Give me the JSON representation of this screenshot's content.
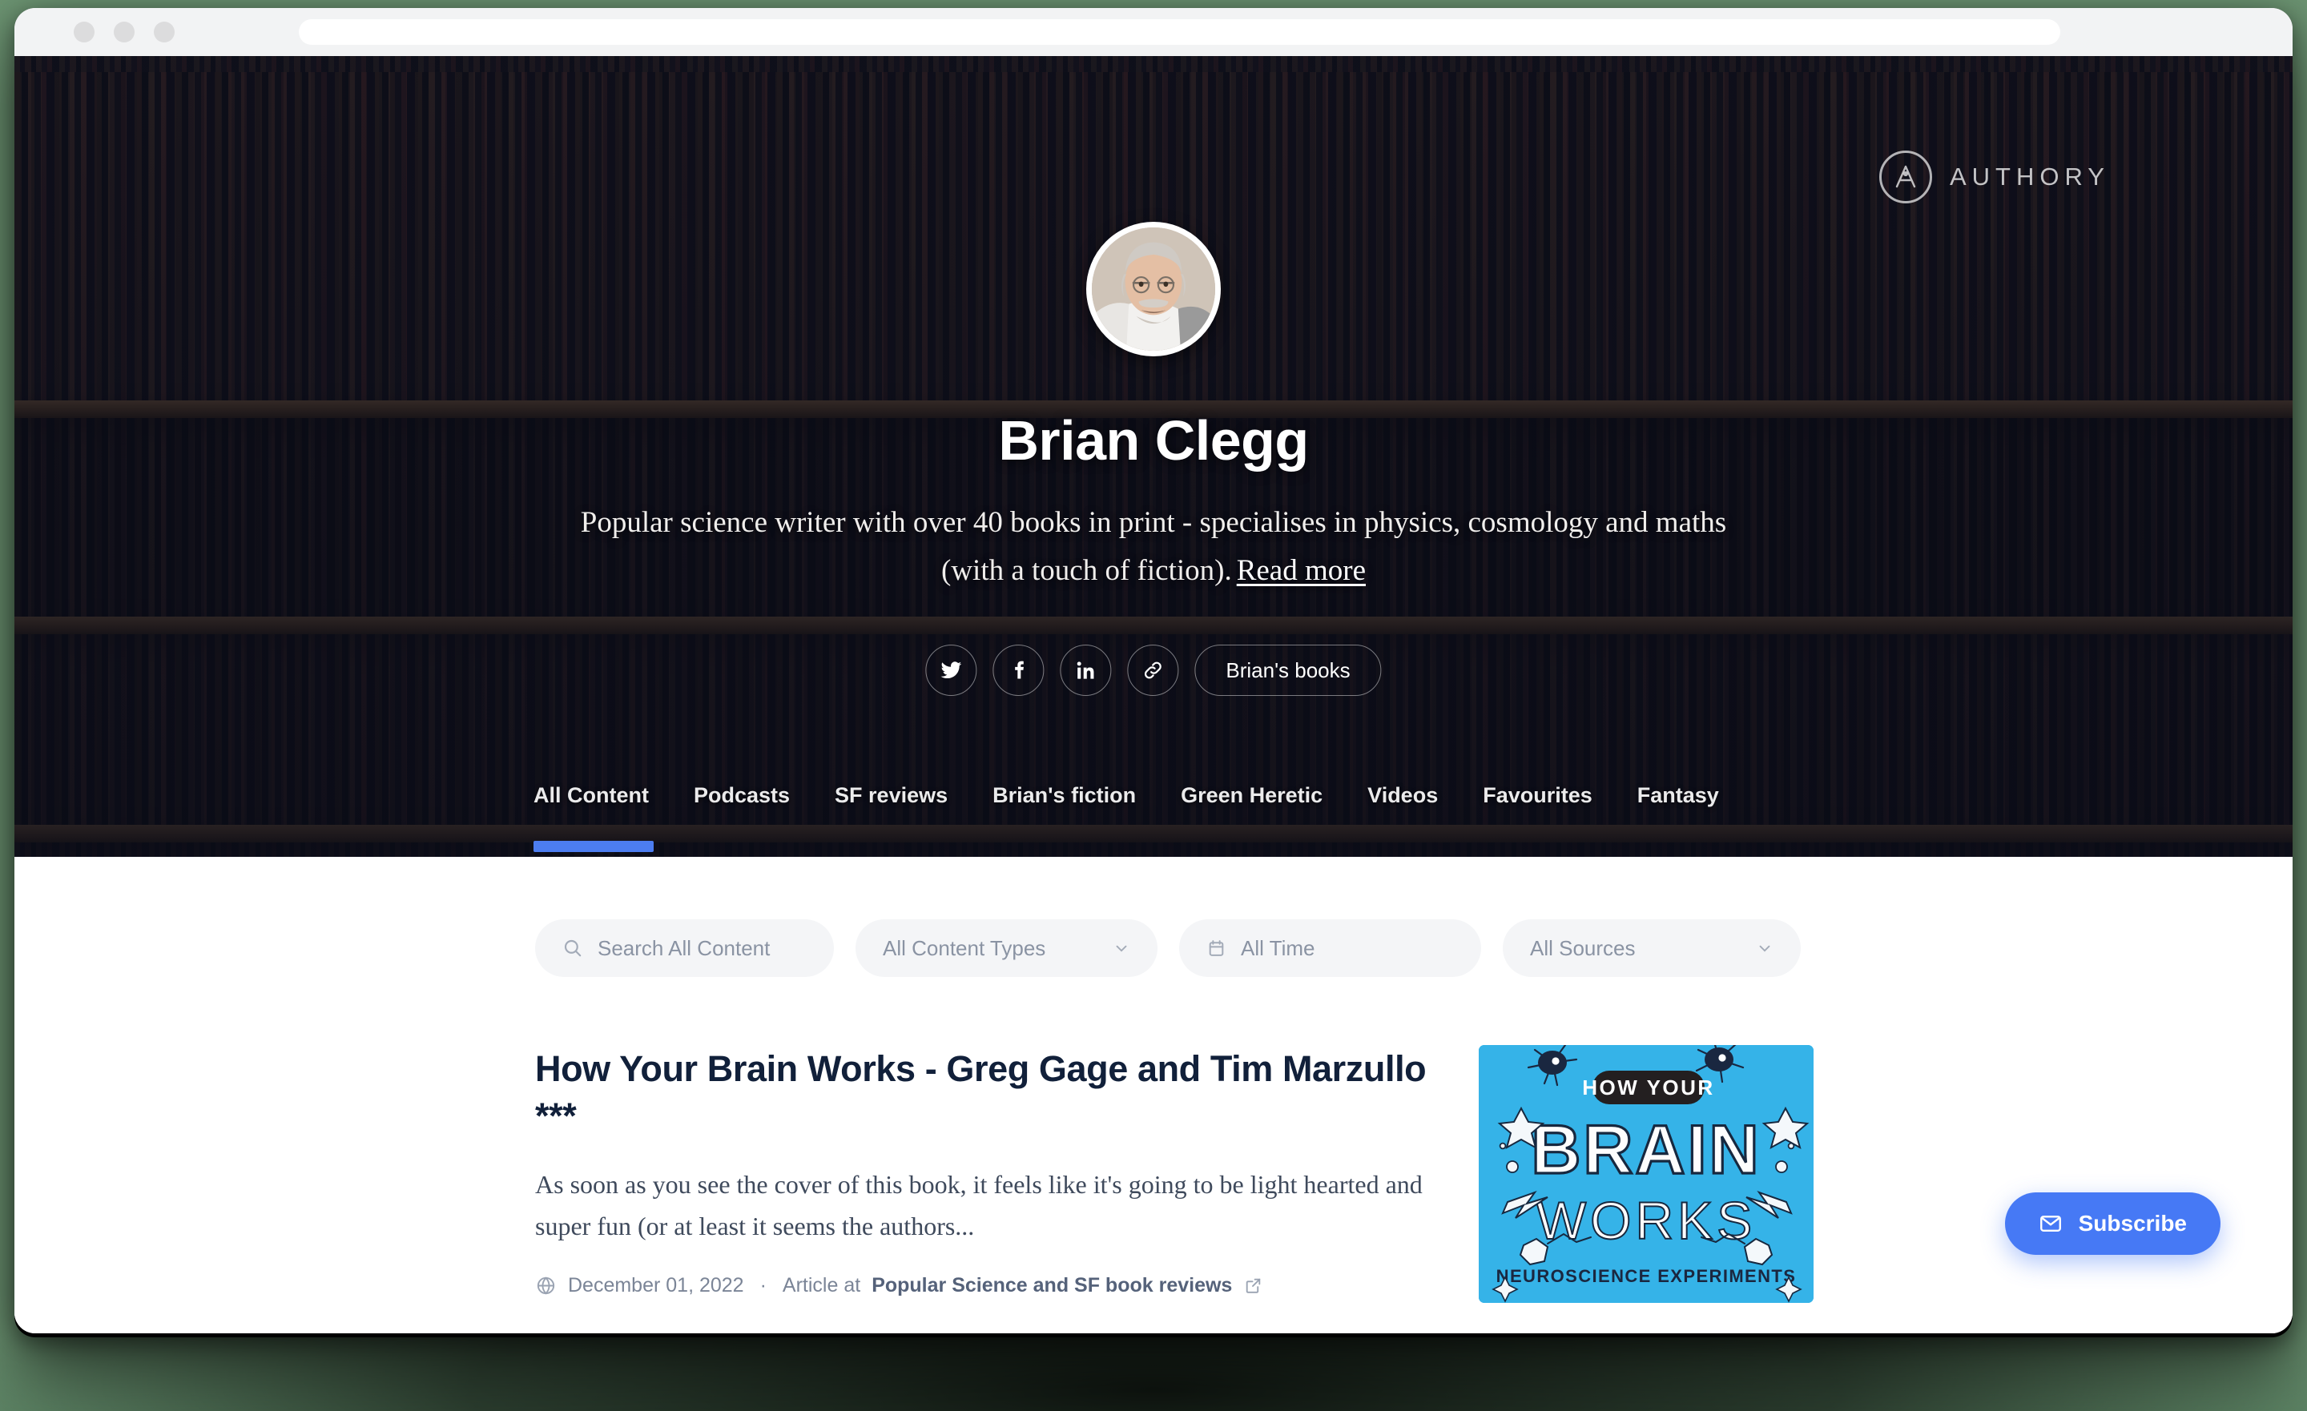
{
  "browser": {
    "url_value": "",
    "url_placeholder": "",
    "traffic_lights": [
      "close",
      "minimize",
      "maximize"
    ]
  },
  "brand": {
    "name": "AUTHORY",
    "mark": "authory-a-mark"
  },
  "profile": {
    "name": "Brian Clegg",
    "bio": "Popular science writer with over 40 books in print - specialises in physics, cosmology and maths (with a touch of fiction).",
    "read_more_label": "Read more",
    "avatar_alt": "Brian Clegg portrait"
  },
  "social": {
    "links": [
      {
        "name": "twitter",
        "icon": "twitter-icon"
      },
      {
        "name": "facebook",
        "icon": "facebook-icon"
      },
      {
        "name": "linkedin",
        "icon": "linkedin-icon"
      },
      {
        "name": "website-link",
        "icon": "link-icon"
      }
    ],
    "books_pill_label": "Brian's books"
  },
  "tabs": [
    {
      "label": "All Content",
      "active": true
    },
    {
      "label": "Podcasts",
      "active": false
    },
    {
      "label": "SF reviews",
      "active": false
    },
    {
      "label": "Brian's fiction",
      "active": false
    },
    {
      "label": "Green Heretic",
      "active": false
    },
    {
      "label": "Videos",
      "active": false
    },
    {
      "label": "Favourites",
      "active": false
    },
    {
      "label": "Fantasy",
      "active": false
    }
  ],
  "filters": {
    "search": {
      "value": "",
      "placeholder": "Search All Content",
      "icon": "search-icon"
    },
    "content_types": {
      "selected": "All Content Types",
      "icon": "chevron-down-icon"
    },
    "time": {
      "selected": "All Time",
      "icon": "calendar-icon"
    },
    "sources": {
      "selected": "All Sources",
      "icon": "chevron-down-icon"
    }
  },
  "articles": [
    {
      "title": "How Your Brain Works - Greg Gage and Tim Marzullo ***",
      "excerpt": "As soon as you see the cover of this book, it feels like it's going to be light hearted and super fun (or at least it seems the authors...",
      "date": "December 01, 2022",
      "separator": "·",
      "type_prefix": "Article at",
      "source": "Popular Science and SF book reviews",
      "globe_icon": "globe-icon",
      "external_icon": "external-link-icon",
      "thumbnail": {
        "top_label": "HOW YOUR",
        "main_line_1": "BRAIN",
        "main_line_2": "WORKS",
        "bottom_label": "NEUROSCIENCE EXPERIMENTS",
        "bg_color": "#35b3e8"
      }
    }
  ],
  "subscribe": {
    "label": "Subscribe",
    "icon": "envelope-icon",
    "color": "#4679f5"
  },
  "colors": {
    "accent_blue": "#4c7df0",
    "page_background": "#6d9573",
    "panel_white": "#ffffff",
    "filter_pill": "#f4f5f7"
  }
}
